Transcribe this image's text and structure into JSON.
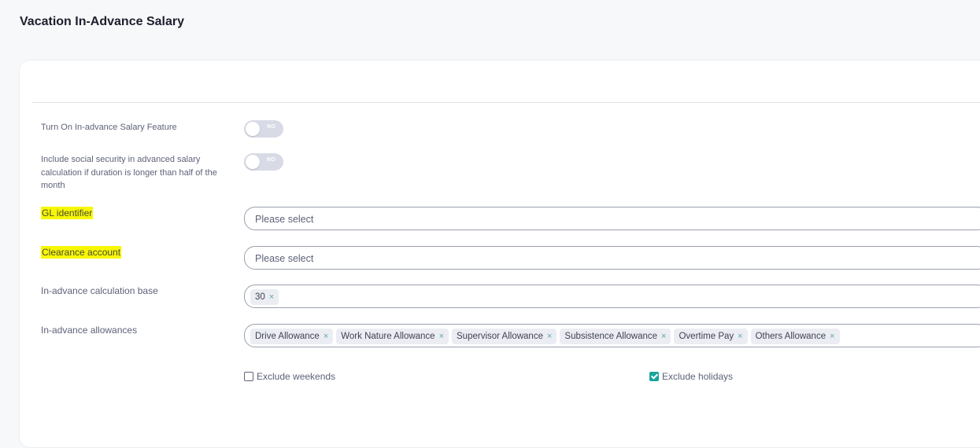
{
  "page": {
    "title": "Vacation In-Advance Salary"
  },
  "settings": {
    "inadvance_feature": {
      "label": "Turn On In-advance Salary Feature",
      "toggle_text": "NO",
      "on": false
    },
    "social_security": {
      "label": "Include social security in advanced salary calculation if duration is longer than half of the month",
      "toggle_text": "NO",
      "on": false
    },
    "gl_identifier": {
      "label": "GL identifier",
      "placeholder": "Please select",
      "highlighted": true
    },
    "clearance_account": {
      "label": "Clearance account",
      "placeholder": "Please select",
      "highlighted": true
    },
    "calc_base": {
      "label": "In-advance calculation base",
      "tags": [
        "30"
      ]
    },
    "allowances": {
      "label": "In-advance allowances",
      "tags": [
        "Drive Allowance",
        "Work Nature Allowance",
        "Supervisor Allowance",
        "Subsistence Allowance",
        "Overtime Pay",
        "Others Allowance"
      ]
    },
    "exclude_weekends": {
      "label": "Exclude weekends",
      "checked": false
    },
    "exclude_holidays": {
      "label": "Exclude holidays",
      "checked": true
    }
  },
  "icons": {
    "remove_tag": "×"
  },
  "colors": {
    "highlight": "#f7f705",
    "accent": "#1ba39c",
    "toggle_off": "#d8dbe6"
  }
}
